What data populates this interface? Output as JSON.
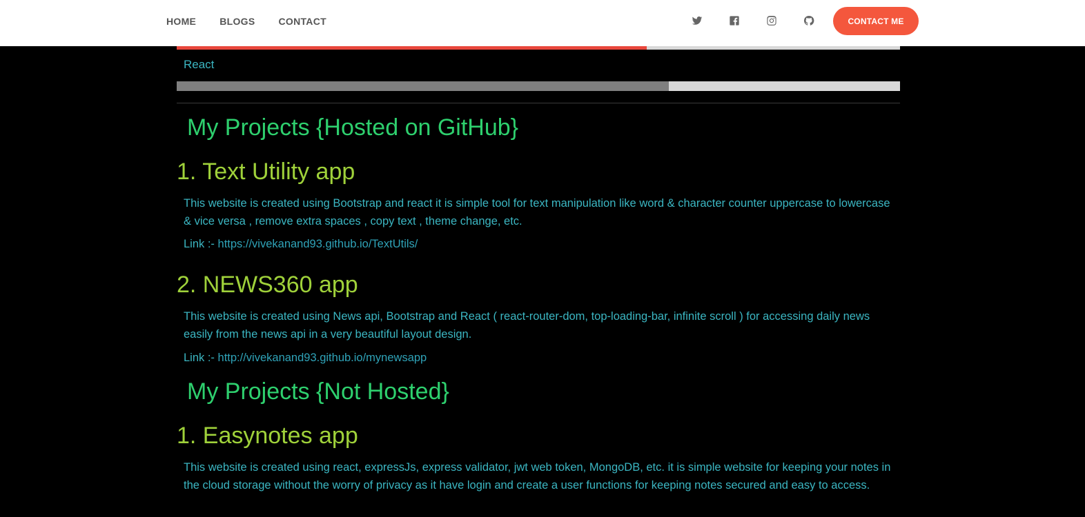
{
  "nav": {
    "links": [
      "HOME",
      "BLOGS",
      "CONTACT"
    ],
    "contact_button": "CONTACT ME",
    "social_icons": [
      "twitter-icon",
      "facebook-icon",
      "instagram-icon",
      "github-icon"
    ]
  },
  "skills": {
    "top_bar": {
      "progress": 0.65,
      "color": "#e9473c"
    },
    "react": {
      "label": "React",
      "progress": 0.68,
      "color": "#7f7f7f"
    }
  },
  "sections": {
    "hosted_heading": "My Projects {Hosted on GitHub}",
    "not_hosted_heading": "My Projects {Not Hosted}"
  },
  "projects": [
    {
      "title": "1. Text Utility app",
      "description": "This website is created using Bootstrap and react it is simple tool for text manipulation like word & character counter uppercase to lowercase & vice versa , remove extra spaces , copy text , theme change, etc.",
      "link_prefix": "Link :-",
      "link": "https://vivekanand93.github.io/TextUtils/"
    },
    {
      "title": "2. NEWS360 app",
      "description": "This website is created using News api, Bootstrap and React ( react-router-dom, top-loading-bar, infinite scroll ) for accessing daily news easily from the news api in a very beautiful layout design.",
      "link_prefix": "Link :-",
      "link": "http://vivekanand93.github.io/mynewsapp"
    },
    {
      "title": "1. Easynotes app",
      "description": "This website is created using react, expressJs, express validator, jwt web token, MongoDB, etc. it is simple website for keeping your notes in the cloud storage without the worry of privacy as it have login and create a user functions for keeping notes secured and easy to access."
    }
  ],
  "colors": {
    "section_heading": "#2ed06e",
    "project_title": "#9fd13a",
    "body_text": "#3bb6c2",
    "accent": "#f4573d"
  }
}
